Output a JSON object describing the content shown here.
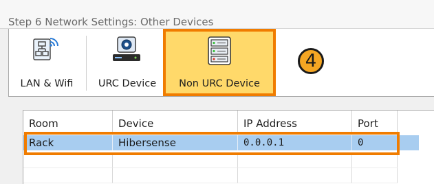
{
  "window": {
    "title": "Step 6 Network Settings: Other Devices"
  },
  "toolbar": {
    "buttons": [
      {
        "label": "LAN & Wifi",
        "icon": "network-wifi-icon"
      },
      {
        "label": "URC Device",
        "icon": "urc-device-icon"
      },
      {
        "label": "Non URC Device",
        "icon": "server-rack-icon",
        "selected": true
      }
    ]
  },
  "annotation": {
    "step": "4",
    "highlight_color": "#f07c00",
    "badge_color": "#f5a623"
  },
  "table": {
    "columns": [
      "Room",
      "Device",
      "IP Address",
      "Port"
    ],
    "rows": [
      {
        "room": "Rack",
        "device": "Hibersense",
        "ip": "0.0.0.1",
        "port": "0",
        "selected": true
      }
    ],
    "selected_row_color": "#a8cdf0"
  }
}
